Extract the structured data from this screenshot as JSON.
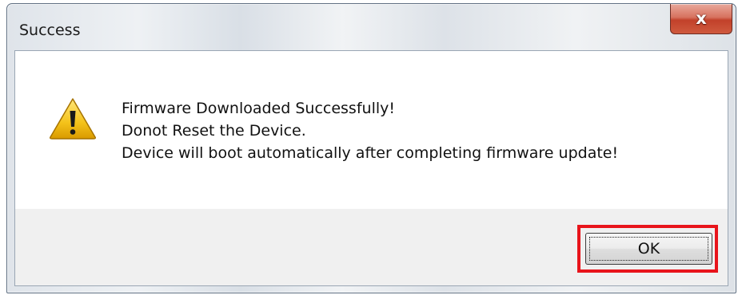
{
  "dialog": {
    "title": "Success",
    "close_glyph": "x",
    "icon": "warning-icon",
    "message_lines": [
      "Firmware Downloaded Successfully!",
      "Donot Reset the Device.",
      "Device will boot automatically after completing firmware update!"
    ],
    "ok_label": "OK"
  },
  "colors": {
    "highlight": "#e8141b",
    "close_button": "#c2412a",
    "warning_yellow": "#f4c21a"
  }
}
